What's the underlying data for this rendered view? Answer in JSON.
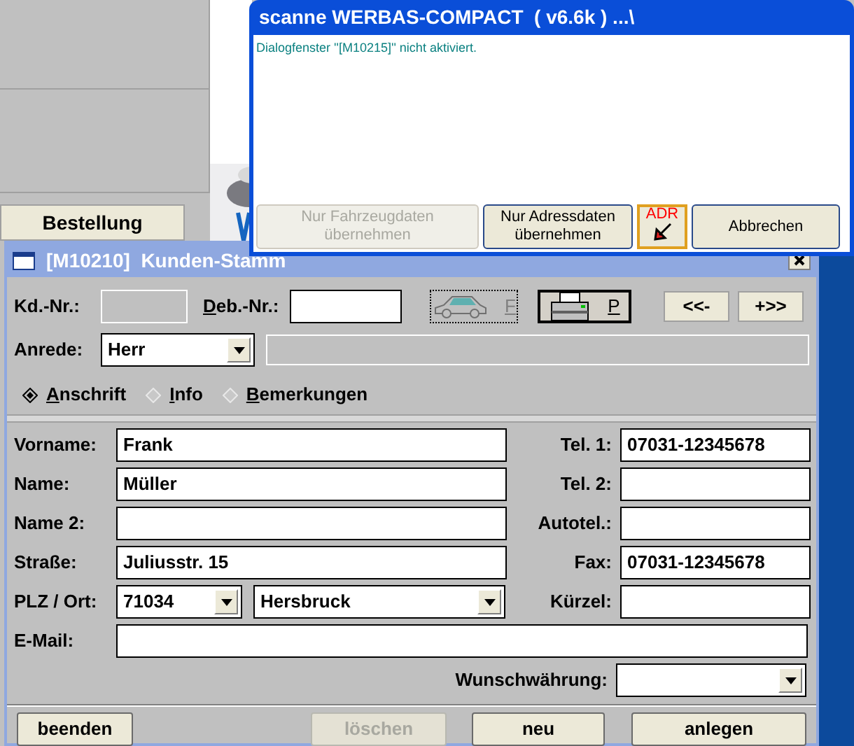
{
  "background_app": {
    "buttons": [
      {
        "label": "Bestellung"
      }
    ]
  },
  "scan_dialog": {
    "title": "scanne WERBAS-COMPACT  ( v6.6k ) ...\\",
    "message": "Dialogfenster ''[M10215]'' nicht aktiviert.",
    "buttons": [
      {
        "kind": "text",
        "label": "Nur Fahrzeugdaten übernehmen",
        "disabled": true
      },
      {
        "kind": "text",
        "label": "Nur Adressdaten übernehmen",
        "disabled": false
      },
      {
        "kind": "icon",
        "label": "ADR"
      },
      {
        "kind": "text",
        "label": "Abbrechen",
        "disabled": false
      }
    ]
  },
  "customer_window": {
    "title": "[M10210]  Kunden-Stamm",
    "kd_nr": {
      "label": "Kd.-Nr.:",
      "disabled": true
    },
    "deb_nr": {
      "label": "Deb.-Nr.:",
      "mnemonic_underlined": true
    },
    "tool_buttons": [
      {
        "kind": "car",
        "label": "F",
        "disabled": true
      },
      {
        "kind": "printer",
        "label": "P",
        "disabled": false
      }
    ],
    "nav_buttons": [
      {
        "label": "<<-"
      },
      {
        "label": "+>>"
      }
    ],
    "anrede": {
      "label": "Anrede:",
      "value": "Herr"
    },
    "radios": [
      {
        "label": "Anschrift",
        "selected": true
      },
      {
        "label": "Info",
        "selected": false
      },
      {
        "label": "Bemerkungen",
        "selected": false
      }
    ],
    "left_fields": [
      {
        "kind": "text",
        "label": "Vorname:",
        "value": "Frank"
      },
      {
        "kind": "text",
        "label": "Name:",
        "value": "Müller"
      },
      {
        "kind": "text",
        "label": "Name 2:"
      },
      {
        "kind": "text",
        "label": "Straße:",
        "value": "Juliusstr. 15"
      },
      {
        "kind": "plz",
        "label": "PLZ / Ort:",
        "value": "71034",
        "city": "Hersbruck"
      }
    ],
    "right_fields": [
      {
        "label": "Tel. 1:",
        "value": "07031-12345678"
      },
      {
        "label": "Tel. 2:"
      },
      {
        "label": "Autotel.:"
      },
      {
        "label": "Fax:",
        "value": "07031-12345678"
      },
      {
        "label": "Kürzel:"
      }
    ],
    "email": {
      "label": "E-Mail:"
    },
    "currency": {
      "label": "Wunschwährung:"
    },
    "footer_buttons": [
      {
        "label": "beenden",
        "disabled": false
      },
      {
        "label": "löschen",
        "disabled": true
      },
      {
        "label": "neu",
        "disabled": false
      },
      {
        "label": "anlegen",
        "disabled": false
      }
    ]
  }
}
